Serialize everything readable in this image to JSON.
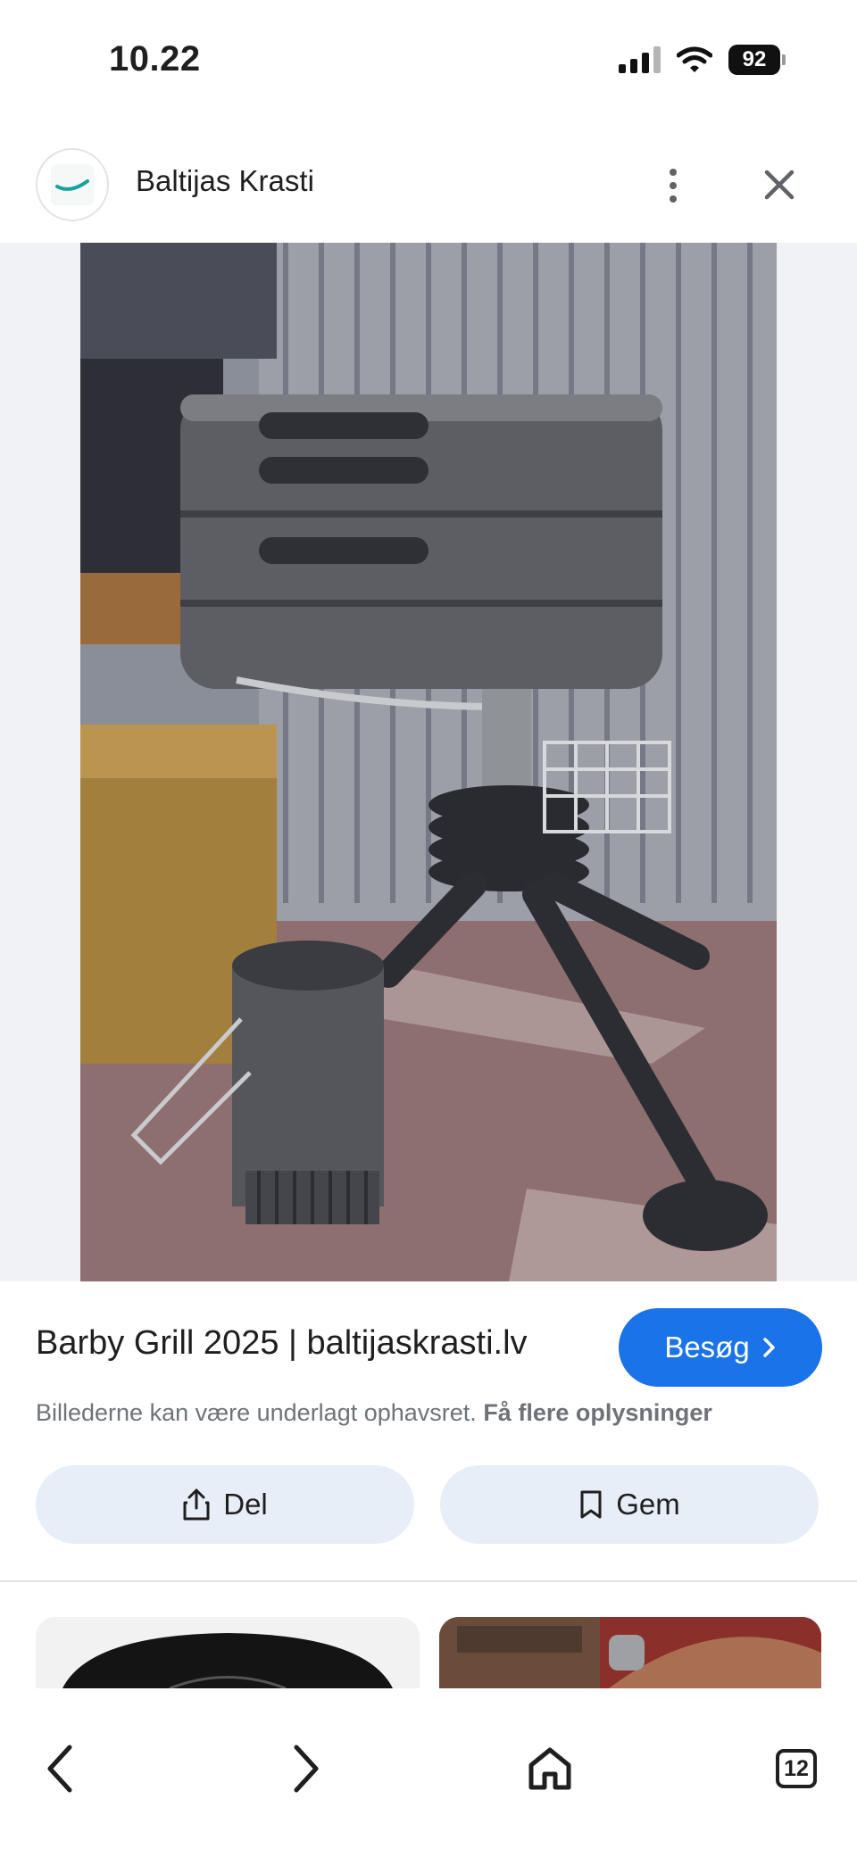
{
  "status_bar": {
    "time": "10.22",
    "battery": "92",
    "icons": [
      "signal-icon",
      "wifi-icon",
      "battery-icon"
    ]
  },
  "header": {
    "source_name": "Baltijas Krasti",
    "icons": [
      "site-logo",
      "more-vert-icon",
      "close-icon"
    ]
  },
  "result": {
    "title": "Barby Grill 2025 | baltijaskrasti.lv",
    "visit_label": "Besøg",
    "copyright_text": "Billederne kan være underlagt ophavsret.",
    "more_info_link": "Få flere oplysninger"
  },
  "actions": {
    "share_label": "Del",
    "save_label": "Gem"
  },
  "bottom_nav": {
    "tab_count": "12",
    "icons": [
      "back-arrow-icon",
      "forward-arrow-icon",
      "home-icon",
      "tabs-icon"
    ]
  },
  "colors": {
    "accent": "#1a73e8",
    "action_button_bg": "#e8eef8",
    "viewer_bg": "#f0f2f5"
  }
}
